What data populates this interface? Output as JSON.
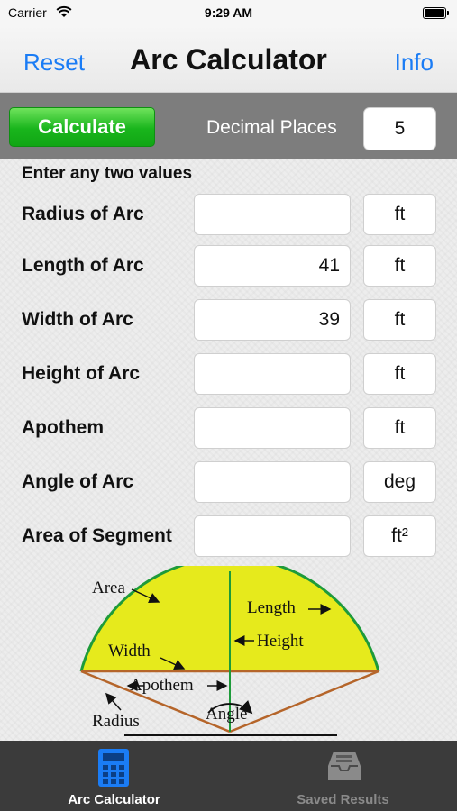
{
  "status": {
    "carrier": "Carrier",
    "time": "9:29 AM"
  },
  "nav": {
    "left": "Reset",
    "title": "Arc Calculator",
    "right": "Info"
  },
  "toolbar": {
    "calculate": "Calculate",
    "decimal_label": "Decimal Places",
    "decimal_value": "5"
  },
  "instruction": "Enter any two values",
  "rows": [
    {
      "label": "Radius of Arc",
      "value": "",
      "unit": "ft"
    },
    {
      "label": "Length of Arc",
      "value": "41",
      "unit": "ft"
    },
    {
      "label": "Width of Arc",
      "value": "39",
      "unit": "ft"
    },
    {
      "label": "Height of Arc",
      "value": "",
      "unit": "ft"
    },
    {
      "label": "Apothem",
      "value": "",
      "unit": "ft"
    },
    {
      "label": "Angle of Arc",
      "value": "",
      "unit": "deg"
    },
    {
      "label": "Area of Segment",
      "value": "",
      "unit": "ft²"
    }
  ],
  "diagram": {
    "labels": {
      "area": "Area",
      "length": "Length",
      "height": "Height",
      "width": "Width",
      "apothem": "Apothem",
      "radius": "Radius",
      "angle": "Angle"
    },
    "colors": {
      "segment_fill": "#e6ea1c",
      "arc": "#1e9b3a",
      "radius_lines": "#b5652a"
    }
  },
  "tabs": [
    {
      "label": "Arc Calculator",
      "icon": "calculator-icon",
      "active": true
    },
    {
      "label": "Saved Results",
      "icon": "inbox-tray-icon",
      "active": false
    }
  ],
  "colors": {
    "accent": "#1a7cf5",
    "button_green": "#19b51c",
    "toolbar": "#7d7d7d",
    "tabbar": "#3b3b3b"
  }
}
